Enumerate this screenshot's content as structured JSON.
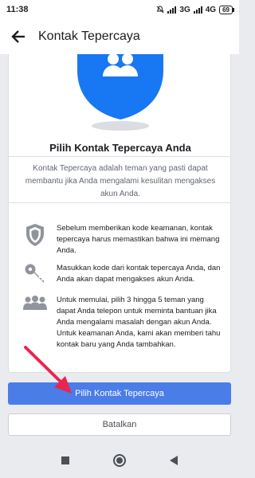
{
  "status_bar": {
    "time": "11:38",
    "network_3g": "3G",
    "network_4g": "4G",
    "battery": "69"
  },
  "app_bar": {
    "title": "Kontak Tepercaya",
    "back_icon": "arrow-left-icon"
  },
  "card": {
    "title": "Pilih Kontak Tepercaya Anda",
    "description": "Kontak Tepercaya adalah teman yang pasti dapat membantu jika Anda mengalami kesulitan mengakses akun Anda.",
    "items": [
      {
        "icon": "shield-icon",
        "text": "Sebelum memberikan kode keamanan, kontak tepercaya harus memastikan bahwa ini memang Anda."
      },
      {
        "icon": "key-icon",
        "text": "Masukkan kode dari kontak tepercaya Anda, dan Anda akan dapat mengakses akun Anda."
      },
      {
        "icon": "people-icon",
        "text": "Untuk memulai, pilih 3 hingga 5 teman yang dapat Anda telepon untuk meminta bantuan jika Anda mengalami masalah dengan akun Anda. Untuk keamanan Anda, kami akan memberi tahu kontak baru yang Anda tambahkan."
      }
    ]
  },
  "buttons": {
    "primary": "Pilih Kontak Tepercaya",
    "secondary": "Batalkan"
  },
  "colors": {
    "primary": "#4a7de8",
    "hero_blue": "#1877f2",
    "annotation": "#e8264f"
  }
}
